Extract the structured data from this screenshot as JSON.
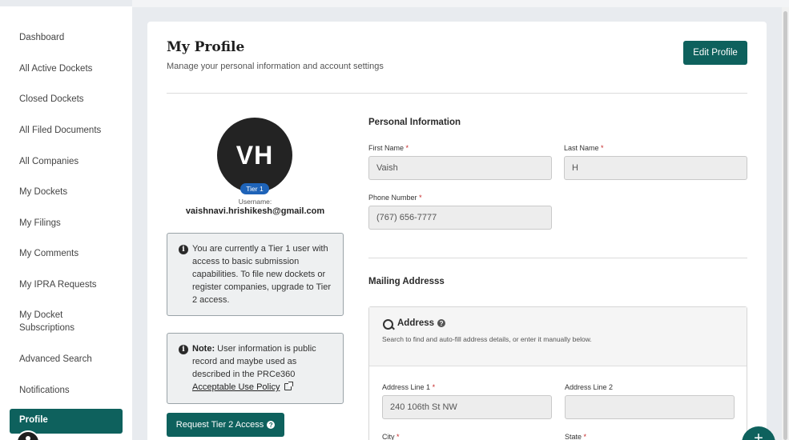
{
  "sidebar": {
    "items": [
      {
        "label": "Dashboard"
      },
      {
        "label": "All Active Dockets"
      },
      {
        "label": "Closed Dockets"
      },
      {
        "label": "All Filed Documents"
      },
      {
        "label": "All Companies"
      },
      {
        "label": "My Dockets"
      },
      {
        "label": "My Filings"
      },
      {
        "label": "My Comments"
      },
      {
        "label": "My IPRA Requests"
      },
      {
        "label": "My Docket Subscriptions"
      },
      {
        "label": "Advanced Search"
      },
      {
        "label": "Notifications"
      }
    ],
    "active_label": "Profile"
  },
  "header": {
    "title": "My Profile",
    "subtitle": "Manage your personal information and account settings",
    "edit_button": "Edit Profile"
  },
  "profile": {
    "initials": "VH",
    "tier_badge": "Tier 1",
    "username_label": "Username:",
    "email": "vaishnavi.hrishikesh@gmail.com"
  },
  "tier_notice": {
    "text": "You are currently a Tier 1 user with access to basic submission capabilities. To file new dockets or register companies, upgrade to Tier 2 access."
  },
  "note_notice": {
    "label": "Note:",
    "text": "User information is public record and maybe used as described in the PRCe360",
    "link": "Acceptable Use Policy"
  },
  "tier2_button": "Request Tier 2 Access",
  "personal": {
    "title": "Personal Information",
    "first_name_label": "First Name",
    "first_name_value": "Vaish",
    "last_name_label": "Last Name",
    "last_name_value": "H",
    "phone_label": "Phone Number",
    "phone_value": "(767) 656-7777"
  },
  "mailing": {
    "title": "Mailing Addresss",
    "address_title": "Address",
    "address_desc": "Search to find and auto-fill address details, or enter it manually below.",
    "line1_label": "Address Line 1",
    "line1_value": "240 106th St NW",
    "line2_label": "Address Line 2",
    "line2_value": "",
    "city_label": "City",
    "state_label": "State"
  },
  "required_mark": "*",
  "colors": {
    "accent": "#0e615d",
    "badge": "#1e63b8",
    "required": "#c62828"
  }
}
